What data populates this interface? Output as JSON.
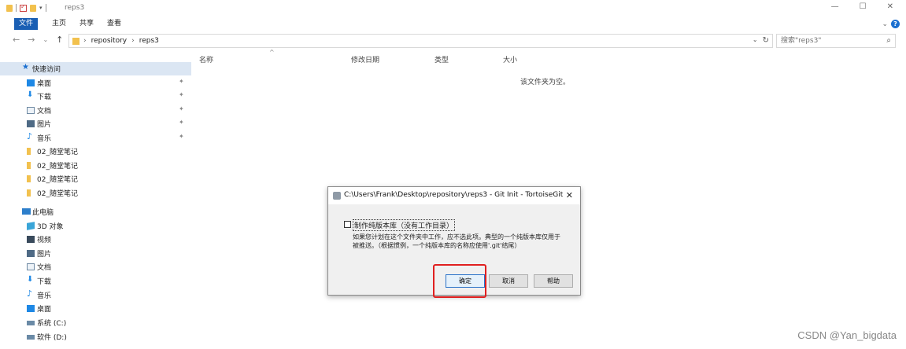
{
  "window": {
    "title": "reps3",
    "controls": {
      "minimize": "—",
      "maximize": "☐",
      "close": "✕"
    }
  },
  "ribbon": {
    "tabs": [
      {
        "label": "文件"
      },
      {
        "label": "主页"
      },
      {
        "label": "共享"
      },
      {
        "label": "查看"
      }
    ]
  },
  "address": {
    "crumbs": [
      "repository",
      "reps3"
    ],
    "separator": "›",
    "search_placeholder": "搜索\"reps3\""
  },
  "sidebar": {
    "quick_access": "快速访问",
    "quick_items": [
      {
        "label": "桌面",
        "icon": "desktop-icon"
      },
      {
        "label": "下载",
        "icon": "download-icon"
      },
      {
        "label": "文档",
        "icon": "document-icon"
      },
      {
        "label": "图片",
        "icon": "picture-icon"
      },
      {
        "label": "音乐",
        "icon": "music-icon"
      },
      {
        "label": "02_随堂笔记",
        "icon": "folder-icon"
      },
      {
        "label": "02_随堂笔记",
        "icon": "folder-icon"
      },
      {
        "label": "02_随堂笔记",
        "icon": "folder-icon"
      },
      {
        "label": "02_随堂笔记",
        "icon": "folder-icon"
      }
    ],
    "this_pc": "此电脑",
    "pc_items": [
      {
        "label": "3D 对象",
        "icon": "3d-objects-icon"
      },
      {
        "label": "视频",
        "icon": "video-icon"
      },
      {
        "label": "图片",
        "icon": "picture-icon"
      },
      {
        "label": "文档",
        "icon": "document-icon"
      },
      {
        "label": "下载",
        "icon": "download-icon"
      },
      {
        "label": "音乐",
        "icon": "music-icon"
      },
      {
        "label": "桌面",
        "icon": "desktop-icon"
      },
      {
        "label": "系统 (C:)",
        "icon": "drive-icon"
      },
      {
        "label": "软件 (D:)",
        "icon": "drive-icon"
      }
    ]
  },
  "columns": {
    "name": "名称",
    "modified": "修改日期",
    "type": "类型",
    "size": "大小"
  },
  "content": {
    "empty_message": "该文件夹为空。"
  },
  "dialog": {
    "title": "C:\\Users\\Frank\\Desktop\\repository\\reps3 - Git Init - TortoiseGit",
    "checkbox_label": "制作纯版本库（没有工作目录）",
    "checkbox_checked": false,
    "description": "如果您计划在这个文件夹中工作，应不选此项。典型的一个纯版本库仅用于被推送。（根据惯例，一个纯版本库的名称应使用'.git'结尾）",
    "ok_label": "确定",
    "cancel_label": "取消",
    "help_label": "帮助"
  },
  "watermark": "CSDN @Yan_bigdata",
  "colors": {
    "accent": "#1a5fb4",
    "folder": "#f2c14e",
    "highlight_box": "#e02020"
  }
}
